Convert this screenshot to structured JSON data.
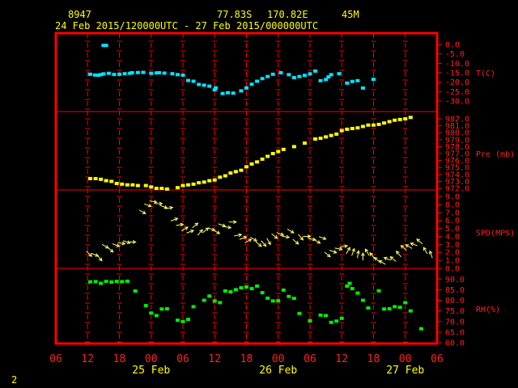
{
  "header": {
    "station_id": "8947",
    "lat": "77.83S",
    "lon": "170.82E",
    "elev": "45M",
    "period": "24 Feb 2015/120000UTC - 27 Feb 2015/000000UTC"
  },
  "footer": {
    "page_number": "2"
  },
  "colors": {
    "frame": "#ff0000",
    "gridline": "#ff0000",
    "temperature": "#00e5ff",
    "pressure": "#ffff00",
    "wind": "#ffff66",
    "humidity": "#00ee00",
    "header_text": "#ffff00"
  },
  "chart_data": {
    "type": "scatter",
    "x_hours_labels": [
      "06",
      "12",
      "18",
      "00",
      "06",
      "12",
      "18",
      "00",
      "06",
      "12",
      "18",
      "00",
      "06"
    ],
    "date_labels": [
      {
        "label": "25 Feb",
        "hour_index": 3
      },
      {
        "label": "26 Feb",
        "hour_index": 7
      },
      {
        "label": "27 Feb",
        "hour_index": 11
      }
    ],
    "panels": [
      {
        "name": "T(C)",
        "ylim": [
          -30,
          0
        ],
        "ticks": [
          "0.0",
          "-5.0",
          "-10.0",
          "-15.0",
          "-20.0",
          "-25.0",
          "-30.0"
        ],
        "tick_values": [
          0,
          -5,
          -10,
          -15,
          -20,
          -25,
          -30
        ],
        "points": [
          [
            -9,
            -0.5
          ],
          [
            -8.5,
            -0.5
          ],
          [
            -11.5,
            -15.8
          ],
          [
            -10.6,
            -16.2
          ],
          [
            -10,
            -16.3
          ],
          [
            -9.5,
            -16.0
          ],
          [
            -9,
            -15.6
          ],
          [
            -8,
            -15.3
          ],
          [
            -7,
            -15.9
          ],
          [
            -6,
            -15.8
          ],
          [
            -5,
            -15.5
          ],
          [
            -4,
            -15.3
          ],
          [
            -3.6,
            -15.0
          ],
          [
            -2.5,
            -14.9
          ],
          [
            -1.5,
            -14.8
          ],
          [
            0,
            -15.3
          ],
          [
            1,
            -15.1
          ],
          [
            1.5,
            -15.0
          ],
          [
            2.5,
            -15.2
          ],
          [
            4,
            -15.5
          ],
          [
            5,
            -16.0
          ],
          [
            6,
            -16.3
          ],
          [
            7,
            -19.1
          ],
          [
            8,
            -19.5
          ],
          [
            9,
            -21.2
          ],
          [
            10,
            -21.6
          ],
          [
            11,
            -22.1
          ],
          [
            12,
            -24.1
          ],
          [
            12.2,
            -23.0
          ],
          [
            13.5,
            -26.0
          ],
          [
            14.5,
            -25.6
          ],
          [
            15.5,
            -25.8
          ],
          [
            17,
            -24.6
          ],
          [
            18,
            -23.0
          ],
          [
            19,
            -21.1
          ],
          [
            20,
            -19.5
          ],
          [
            21,
            -18.1
          ],
          [
            22,
            -17.0
          ],
          [
            23,
            -15.8
          ],
          [
            24.5,
            -15.0
          ],
          [
            26,
            -16.0
          ],
          [
            27,
            -17.6
          ],
          [
            28,
            -17.0
          ],
          [
            29,
            -16.4
          ],
          [
            30,
            -15.6
          ],
          [
            31,
            -14.1
          ],
          [
            32,
            -19.2
          ],
          [
            33,
            -18.6
          ],
          [
            33.5,
            -17.2
          ],
          [
            34,
            -16.0
          ],
          [
            35.5,
            -15.5
          ],
          [
            37,
            -20.5
          ],
          [
            38,
            -19.6
          ],
          [
            39,
            -19.2
          ],
          [
            40,
            -23.1
          ],
          [
            42,
            -18.5
          ]
        ]
      },
      {
        "name": "Pre (mb)",
        "ylim": [
          972,
          982
        ],
        "ticks": [
          "982.0",
          "981.0",
          "980.0",
          "979.0",
          "978.0",
          "977.0",
          "976.0",
          "975.0",
          "974.0",
          "973.0",
          "972.0"
        ],
        "tick_values": [
          982,
          981,
          980,
          979,
          978,
          977,
          976,
          975,
          974,
          973,
          972
        ],
        "points": [
          [
            -11.5,
            973.4
          ],
          [
            -10.5,
            973.4
          ],
          [
            -9.5,
            973.3
          ],
          [
            -8.5,
            973.1
          ],
          [
            -7.5,
            973.0
          ],
          [
            -6.5,
            972.7
          ],
          [
            -5.5,
            972.6
          ],
          [
            -4.5,
            972.5
          ],
          [
            -3.5,
            972.5
          ],
          [
            -2.5,
            972.4
          ],
          [
            -1,
            972.4
          ],
          [
            0,
            972.2
          ],
          [
            1,
            972.0
          ],
          [
            2,
            972.0
          ],
          [
            3,
            971.9
          ],
          [
            5,
            972.1
          ],
          [
            6,
            972.4
          ],
          [
            7,
            972.5
          ],
          [
            8,
            972.6
          ],
          [
            9,
            972.8
          ],
          [
            10,
            972.9
          ],
          [
            11,
            973.1
          ],
          [
            12,
            973.2
          ],
          [
            13,
            973.6
          ],
          [
            14,
            973.8
          ],
          [
            15,
            974.2
          ],
          [
            16,
            974.4
          ],
          [
            17,
            974.6
          ],
          [
            18,
            975.1
          ],
          [
            19,
            975.5
          ],
          [
            20,
            975.8
          ],
          [
            21,
            976.2
          ],
          [
            22,
            976.6
          ],
          [
            23,
            977.0
          ],
          [
            24,
            977.3
          ],
          [
            25,
            977.6
          ],
          [
            27,
            978.0
          ],
          [
            29,
            978.5
          ],
          [
            31,
            979.1
          ],
          [
            32,
            979.2
          ],
          [
            33,
            979.4
          ],
          [
            34,
            979.6
          ],
          [
            35,
            979.8
          ],
          [
            36,
            980.3
          ],
          [
            37,
            980.5
          ],
          [
            38,
            980.6
          ],
          [
            39,
            980.7
          ],
          [
            40,
            980.9
          ],
          [
            41,
            981.1
          ],
          [
            42,
            981.1
          ],
          [
            43,
            981.2
          ],
          [
            44,
            981.4
          ],
          [
            45,
            981.6
          ],
          [
            46,
            981.8
          ],
          [
            47,
            981.9
          ],
          [
            48,
            982.0
          ],
          [
            49,
            982.2
          ]
        ]
      },
      {
        "name": "SPD(MPS)",
        "ylim": [
          0,
          9
        ],
        "ticks": [
          "9.0",
          "8.0",
          "7.0",
          "6.0",
          "5.0",
          "4.0",
          "3.0",
          "2.0",
          "1.0",
          "0.0"
        ],
        "tick_values": [
          9,
          8,
          7,
          6,
          5,
          4,
          3,
          2,
          1,
          0
        ],
        "points": [
          [
            -12,
            2.0,
            225
          ],
          [
            -11,
            1.8,
            200
          ],
          [
            -10,
            1.5,
            230
          ],
          [
            -9,
            2.9,
            210
          ],
          [
            -8,
            2.5,
            220
          ],
          [
            -7,
            3.0,
            200
          ],
          [
            -6,
            3.2,
            190
          ],
          [
            -5,
            3.4,
            200
          ],
          [
            -4,
            3.3,
            180
          ],
          [
            -2,
            7.2,
            210
          ],
          [
            -1,
            8.0,
            200
          ],
          [
            0,
            8.4,
            190
          ],
          [
            1,
            8.1,
            180
          ],
          [
            2,
            7.8,
            200
          ],
          [
            3,
            7.5,
            170
          ],
          [
            4,
            6.0,
            160
          ],
          [
            5,
            5.4,
            170
          ],
          [
            6,
            4.8,
            150
          ],
          [
            7,
            4.5,
            160
          ],
          [
            8,
            5.2,
            140
          ],
          [
            9,
            4.3,
            130
          ],
          [
            10,
            4.6,
            140
          ],
          [
            11,
            5.0,
            200
          ],
          [
            12,
            4.7,
            210
          ],
          [
            13,
            5.5,
            200
          ],
          [
            14,
            5.2,
            190
          ],
          [
            15,
            5.8,
            180
          ],
          [
            16,
            4.1,
            170
          ],
          [
            17,
            3.7,
            160
          ],
          [
            18,
            3.3,
            150
          ],
          [
            19,
            3.8,
            210
          ],
          [
            20,
            3.2,
            220
          ],
          [
            21,
            3.3,
            230
          ],
          [
            22,
            3.6,
            240
          ],
          [
            23,
            4.2,
            220
          ],
          [
            24,
            4.4,
            200
          ],
          [
            25,
            4.0,
            190
          ],
          [
            26,
            4.8,
            210
          ],
          [
            27,
            3.5,
            220
          ],
          [
            28,
            4.1,
            230
          ],
          [
            29,
            4.0,
            180
          ],
          [
            30,
            3.7,
            190
          ],
          [
            31,
            3.5,
            210
          ],
          [
            32,
            3.9,
            200
          ],
          [
            33,
            1.9,
            220
          ],
          [
            34,
            2.2,
            200
          ],
          [
            35,
            2.5,
            190
          ],
          [
            36,
            2.7,
            170
          ],
          [
            37,
            2.0,
            120
          ],
          [
            38,
            1.8,
            110
          ],
          [
            39,
            1.5,
            100
          ],
          [
            40,
            1.2,
            90
          ],
          [
            41,
            1.8,
            60
          ],
          [
            42,
            1.4,
            50
          ],
          [
            43,
            0.9,
            40
          ],
          [
            44,
            0.6,
            30
          ],
          [
            45,
            1.1,
            20
          ],
          [
            46,
            1.0,
            40
          ],
          [
            47,
            1.6,
            50
          ],
          [
            48,
            2.4,
            40
          ],
          [
            49,
            2.6,
            30
          ],
          [
            50,
            2.9,
            20
          ],
          [
            51,
            3.2,
            40
          ],
          [
            52,
            2.0,
            60
          ],
          [
            53,
            1.5,
            70
          ]
        ]
      },
      {
        "name": "RH(%)",
        "ylim": [
          60,
          92
        ],
        "ticks": [
          "90.0",
          "85.0",
          "80.0",
          "75.0",
          "70.0",
          "65.0",
          "60.0"
        ],
        "tick_values": [
          90,
          85,
          80,
          75,
          70,
          65,
          60
        ],
        "points": [
          [
            -11.5,
            88.7
          ],
          [
            -10.5,
            88.8
          ],
          [
            -9.5,
            88.0
          ],
          [
            -8.5,
            88.9
          ],
          [
            -7.5,
            88.6
          ],
          [
            -6.5,
            88.9
          ],
          [
            -5.5,
            88.8
          ],
          [
            -4.5,
            89.0
          ],
          [
            -3,
            84.4
          ],
          [
            -1,
            77.5
          ],
          [
            0,
            74.0
          ],
          [
            1,
            72.8
          ],
          [
            2,
            75.9
          ],
          [
            3,
            76.0
          ],
          [
            5,
            70.6
          ],
          [
            6,
            70.0
          ],
          [
            7,
            71.0
          ],
          [
            8,
            77.0
          ],
          [
            10,
            80.0
          ],
          [
            11,
            82.0
          ],
          [
            12,
            79.7
          ],
          [
            13,
            78.9
          ],
          [
            14,
            84.4
          ],
          [
            15,
            84.0
          ],
          [
            16,
            85.0
          ],
          [
            17,
            85.9
          ],
          [
            18,
            86.3
          ],
          [
            19,
            85.5
          ],
          [
            20,
            86.7
          ],
          [
            21,
            83.6
          ],
          [
            22,
            81.0
          ],
          [
            23,
            79.7
          ],
          [
            24,
            79.8
          ],
          [
            25,
            84.8
          ],
          [
            26,
            81.8
          ],
          [
            27,
            80.9
          ],
          [
            28,
            73.8
          ],
          [
            30,
            70.4
          ],
          [
            32,
            73.0
          ],
          [
            33,
            72.8
          ],
          [
            34,
            69.6
          ],
          [
            35,
            70.2
          ],
          [
            36,
            71.5
          ],
          [
            37,
            86.7
          ],
          [
            37.5,
            88.0
          ],
          [
            38,
            85.5
          ],
          [
            39,
            83.4
          ],
          [
            40,
            80.0
          ],
          [
            41,
            76.4
          ],
          [
            43,
            84.5
          ],
          [
            44,
            75.9
          ],
          [
            45,
            76.0
          ],
          [
            46,
            77.0
          ],
          [
            47,
            76.7
          ],
          [
            48,
            78.9
          ],
          [
            49,
            75.0
          ],
          [
            51,
            66.6
          ]
        ]
      }
    ]
  }
}
